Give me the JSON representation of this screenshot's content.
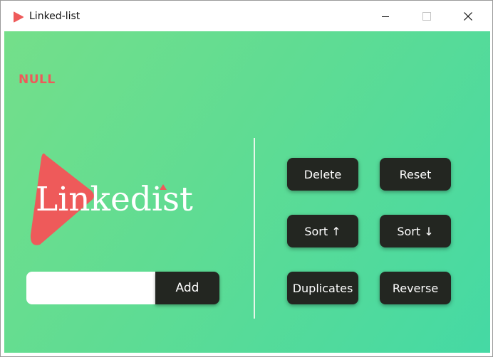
{
  "window": {
    "title": "Linked-list",
    "icon": "red-play-triangle-icon",
    "controls": [
      "minimize-icon",
      "maximize-icon",
      "close-icon"
    ]
  },
  "list": {
    "display": "NULL"
  },
  "logo": {
    "text": "Linkedist",
    "color": "#ee5a5a"
  },
  "add": {
    "input_value": "",
    "button_label": "Add"
  },
  "operations": {
    "delete": "Delete",
    "reset": "Reset",
    "sort_asc": "Sort ↑",
    "sort_desc": "Sort ↓",
    "duplicates": "Duplicates",
    "reverse": "Reverse"
  },
  "colors": {
    "gradient_start": "#74df8a",
    "gradient_end": "#45d9a4",
    "button_bg": "#232621",
    "accent_red": "#ee5a5a"
  }
}
